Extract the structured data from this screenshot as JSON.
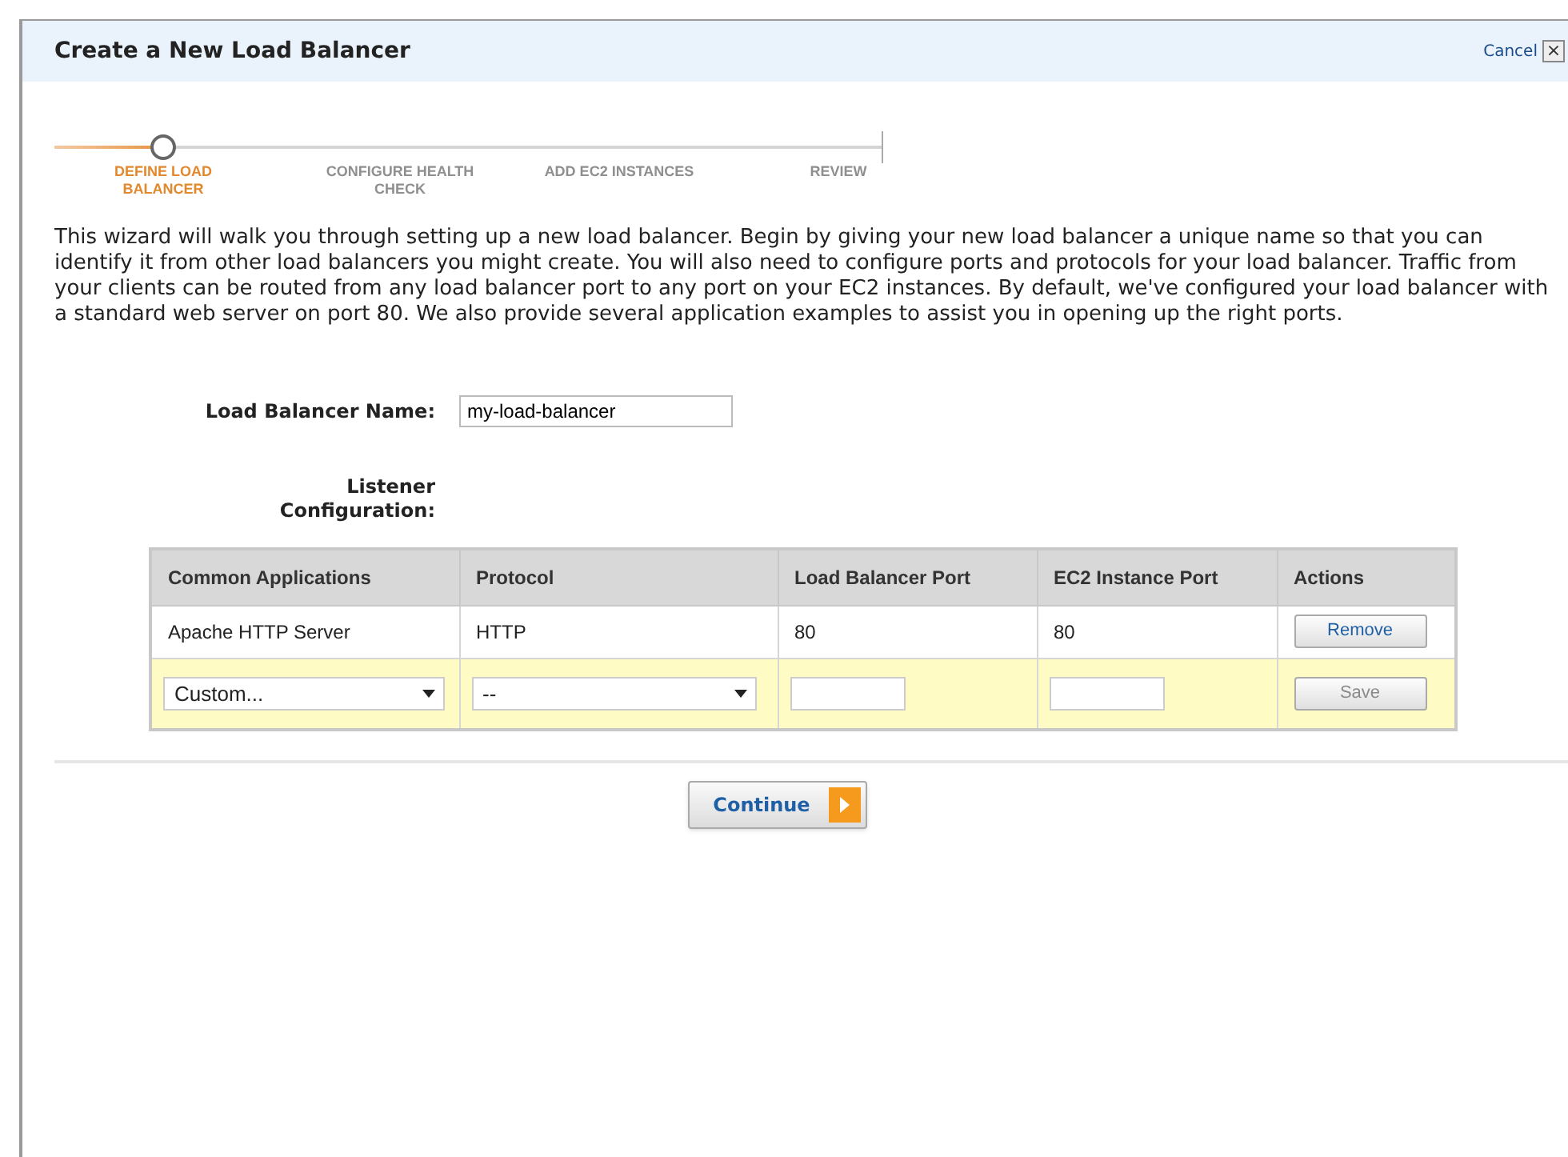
{
  "window": {
    "title": "Create a New Load Balancer",
    "cancel": "Cancel",
    "close": "×"
  },
  "steps": [
    {
      "label": "DEFINE LOAD BALANCER",
      "selected": true
    },
    {
      "label": "CONFIGURE HEALTH CHECK",
      "selected": false
    },
    {
      "label": "ADD EC2 INSTANCES",
      "selected": false
    },
    {
      "label": "REVIEW",
      "selected": false
    }
  ],
  "intro": "This wizard will walk you through setting up a new load balancer. Begin by giving your new load balancer a unique name so that you can identify it from other load balancers you might create. You will also need to configure ports and protocols for your load balancer. Traffic from your clients can be routed from any load balancer port to any port on your EC2 instances. By default, we've configured your load balancer with a standard web server on port 80. We also provide several application examples to assist you in opening up the right ports.",
  "name_field": {
    "label": "Load Balancer Name:",
    "value": "my-load-balancer"
  },
  "listener_label": "Listener Configuration:",
  "table": {
    "columns": [
      "Common Applications",
      "Protocol",
      "Load Balancer Port",
      "EC2 Instance Port",
      "Actions"
    ],
    "rows": [
      {
        "kind": "static",
        "application": "Apache HTTP Server",
        "protocol": "HTTP",
        "lb_port": "80",
        "instance_port": "80",
        "action": {
          "label": "Remove",
          "disabled": false
        }
      },
      {
        "kind": "edit",
        "application": "Custom...",
        "protocol": "--",
        "action": {
          "label": "Save",
          "disabled": true
        }
      }
    ]
  },
  "continue": "Continue"
}
